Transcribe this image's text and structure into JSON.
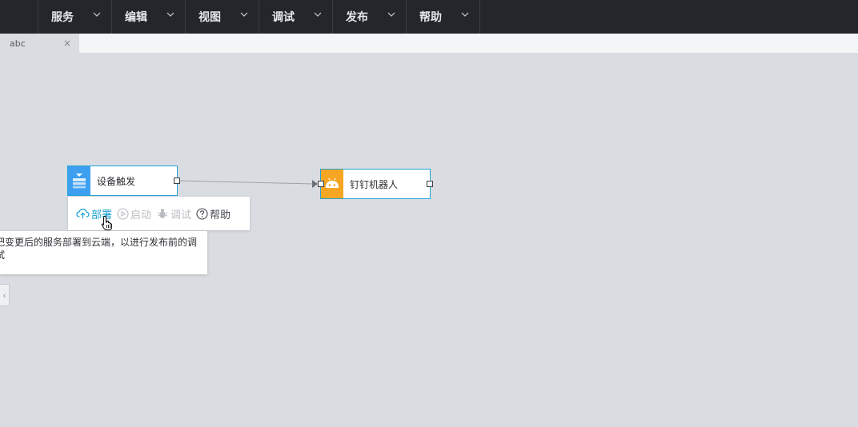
{
  "menubar": {
    "menus": [
      {
        "label": "服务"
      },
      {
        "label": "编辑"
      },
      {
        "label": "视图"
      },
      {
        "label": "调试"
      },
      {
        "label": "发布"
      },
      {
        "label": "帮助"
      }
    ]
  },
  "tabs": [
    {
      "label": "abc",
      "close": "×"
    }
  ],
  "canvas": {
    "nodes": [
      {
        "label": "设备触发",
        "icon": "device-trigger-icon",
        "color": "#3d9ff0"
      },
      {
        "label": "钉钉机器人",
        "icon": "robot-icon",
        "color": "#f6a623"
      }
    ],
    "toolbar": {
      "deploy_label": "部署",
      "start_label": "启动",
      "debug_label": "调试",
      "help_label": "帮助"
    },
    "tooltip": {
      "text": "把变更后的服务部署到云端，以进行发布前的调试"
    },
    "collapse_handle": "‹"
  },
  "colors": {
    "accent": "#23a3d8",
    "menubar_bg": "#24262b",
    "canvas_bg": "#d9dce1"
  }
}
